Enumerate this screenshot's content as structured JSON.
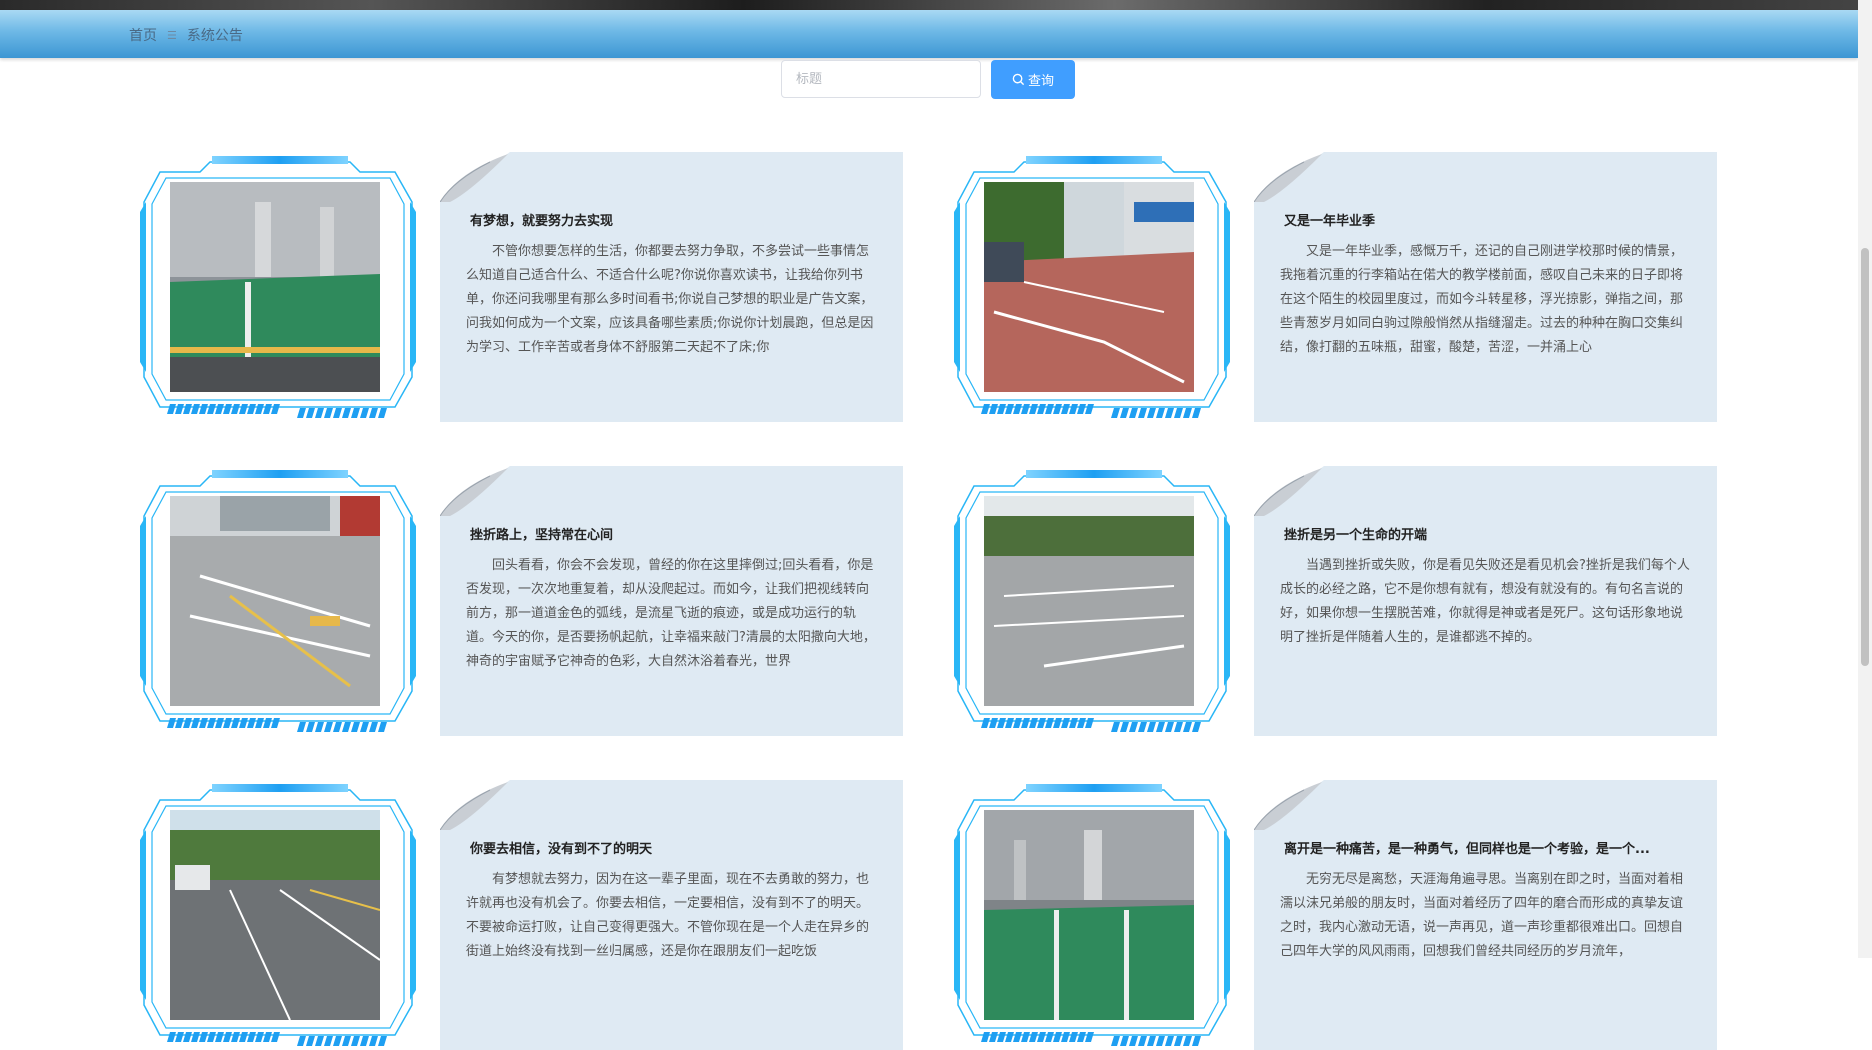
{
  "breadcrumb": {
    "home": "首页",
    "separator": "☰",
    "current": "系统公告"
  },
  "search": {
    "placeholder": "标题",
    "button_label": "查询"
  },
  "colors": {
    "accent": "#409eff",
    "panel": "#dfeaf3",
    "frame": "#29b6f6"
  },
  "cards": [
    {
      "title": "有梦想，就要努力去实现",
      "text": "不管你想要怎样的生活，你都要去努力争取，不多尝试一些事情怎么知道自己适合什么、不适合什么呢?你说你喜欢读书，让我给你列书单，你还问我哪里有那么多时间看书;你说自己梦想的职业是广告文案，问我如何成为一个文案，应该具备哪些素质;你说你计划晨跑，但总是因为学习、工作辛苦或者身体不舒服第二天起不了床;你",
      "photo": "garage"
    },
    {
      "title": "又是一年毕业季",
      "text": "又是一年毕业季，感慨万千，还记的自己刚进学校那时候的情景，我拖着沉重的行李箱站在偌大的教学楼前面，感叹自己未来的日子即将在这个陌生的校园里度过，而如今斗转星移，浮光掠影，弹指之间，那些青葱岁月如同白驹过隙般悄然从指缝溜走。过去的种种在胸口交集纠结，像打翻的五味瓶，甜蜜，酸楚，苦涩，一并涌上心",
      "photo": "street"
    },
    {
      "title": "挫折路上，坚持常在心间",
      "text": "回头看看，你会不会发现，曾经的你在这里摔倒过;回头看看，你是否发现，一次次地重复着，却从没爬起过。而如今，让我们把视线转向前方，那一道道金色的弧线，是流星飞逝的痕迹，或是成功运行的轨道。今天的你，是否要扬帆起航，让幸福来敲门?清晨的太阳撒向大地，神奇的宇宙赋予它神奇的色彩，大自然沐浴着春光，世界",
      "photo": "lot"
    },
    {
      "title": "挫折是另一个生命的开端",
      "text": "当遇到挫折或失败，你是看见失败还是看见机会?挫折是我们每个人成长的必经之路，它不是你想有就有，想没有就没有的。有句名言说的好，如果你想一生摆脱苦难，你就得是神或者是死尸。这句话形象地说明了挫折是伴随着人生的，是谁都逃不掉的。",
      "photo": "outdoor"
    },
    {
      "title": "你要去相信，没有到不了的明天",
      "text": "有梦想就去努力，因为在这一辈子里面，现在不去勇敢的努力，也许就再也没有机会了。你要去相信，一定要相信，没有到不了的明天。不要被命运打败，让自己变得更强大。不管你现在是一个人走在异乡的街道上始终没有找到一丝归属感，还是你在跟朋友们一起吃饭",
      "photo": "road"
    },
    {
      "title": "离开是一种痛苦，是一种勇气，但同样也是一个考验，是一个...",
      "text": "无穷无尽是离愁，天涯海角遍寻思。当离别在即之时，当面对着相濡以沫兄弟般的朋友时，当面对着经历了四年的磨合而形成的真挚友谊之时，我内心激动无语，说一声再见，道一声珍重都很难出口。回想自己四年大学的风风雨雨，回想我们曾经共同经历的岁月流年，",
      "photo": "garage2"
    }
  ]
}
